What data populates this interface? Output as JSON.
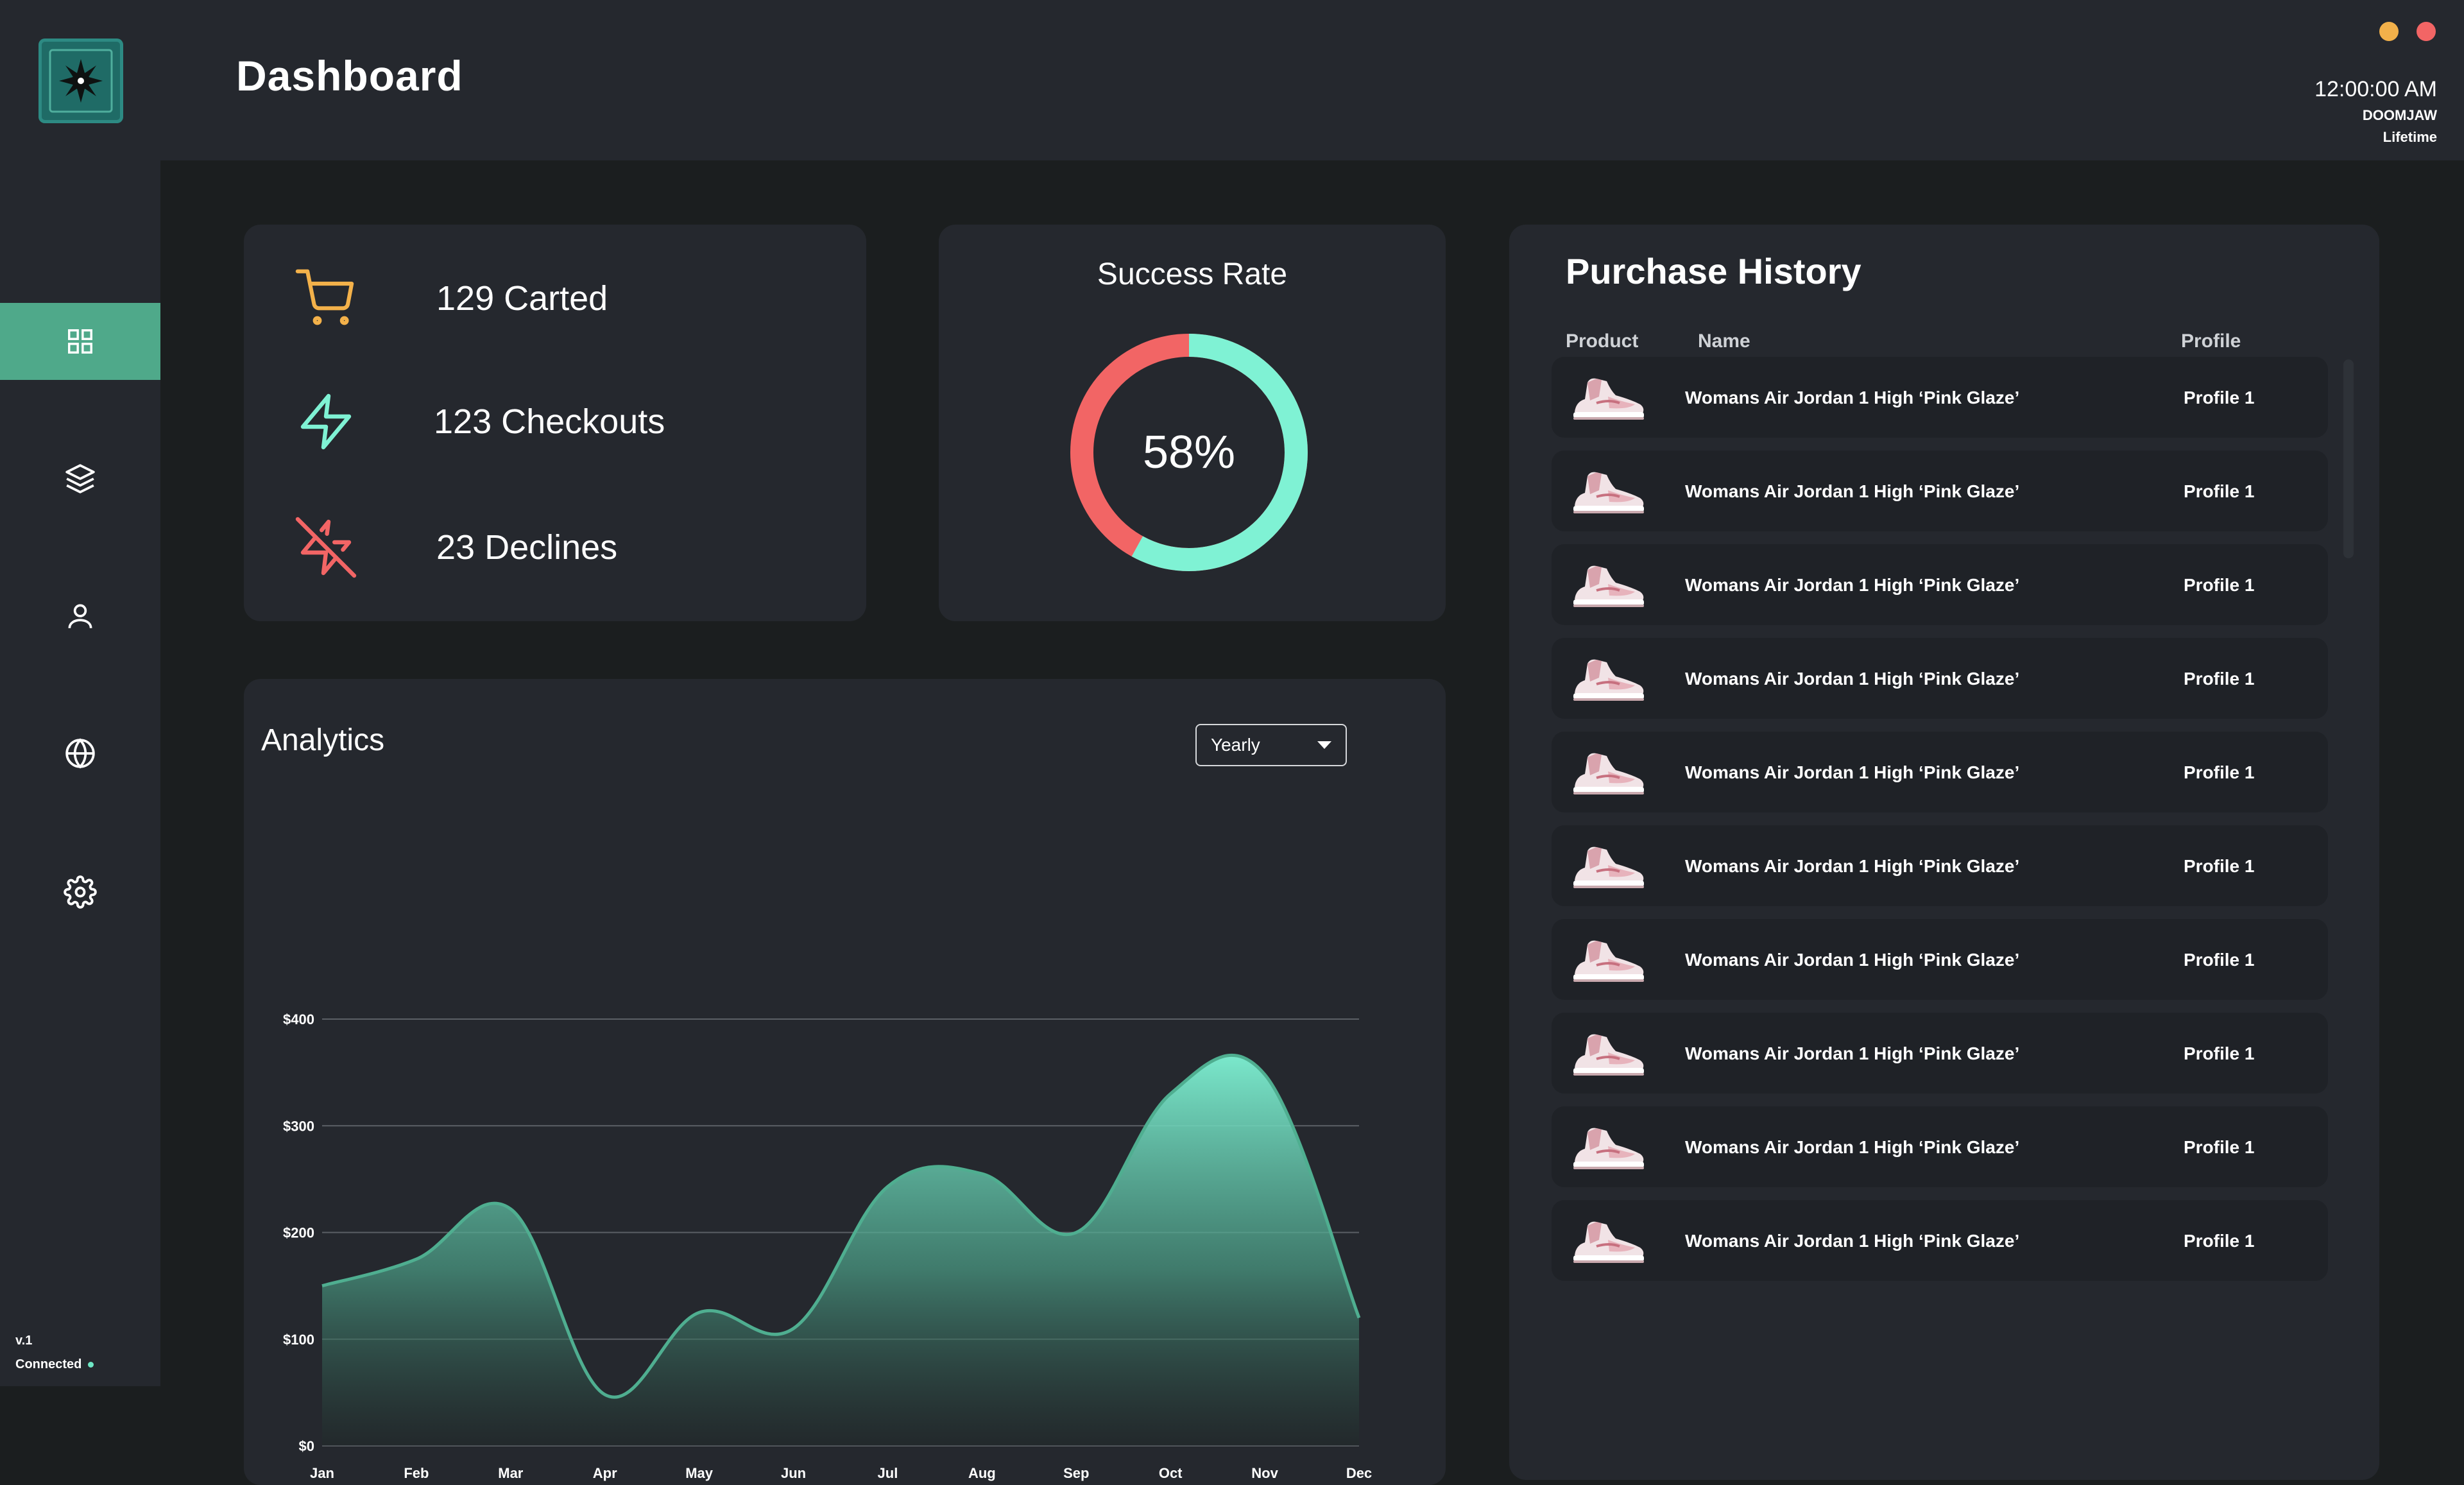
{
  "header": {
    "title": "Dashboard",
    "time": "12:00:00 AM",
    "user": "DOOMJAW",
    "plan": "Lifetime"
  },
  "sidebar": {
    "items": [
      {
        "icon": "grid-icon",
        "active": true
      },
      {
        "icon": "layers-icon",
        "active": false
      },
      {
        "icon": "user-icon",
        "active": false
      },
      {
        "icon": "globe-icon",
        "active": false
      },
      {
        "icon": "gear-icon",
        "active": false
      }
    ],
    "version": "v.1",
    "status": "Connected"
  },
  "stats": {
    "carted": "129 Carted",
    "checkouts": "123 Checkouts",
    "declines": "23 Declines"
  },
  "success_rate": {
    "title": "Success Rate",
    "label": "58%",
    "value": 0.58
  },
  "analytics": {
    "title": "Analytics",
    "period": "Yearly"
  },
  "chart_data": {
    "type": "area",
    "categories": [
      "Jan",
      "Feb",
      "Mar",
      "Apr",
      "May",
      "Jun",
      "Jul",
      "Aug",
      "Sep",
      "Oct",
      "Nov",
      "Dec"
    ],
    "series": [
      {
        "values": [
          150,
          175,
          222,
          48,
          125,
          110,
          243,
          255,
          200,
          330,
          348,
          120
        ]
      }
    ],
    "y_ticks": [
      "$0",
      "$100",
      "$200",
      "$300",
      "$400"
    ],
    "ylim": [
      0,
      400
    ],
    "grid": true
  },
  "purchase_history": {
    "title": "Purchase History",
    "columns": {
      "product": "Product",
      "name": "Name",
      "profile": "Profile"
    },
    "rows": [
      {
        "name": "Womans Air Jordan 1 High ‘Pink Glaze’",
        "profile": "Profile 1"
      },
      {
        "name": "Womans Air Jordan 1 High ‘Pink Glaze’",
        "profile": "Profile 1"
      },
      {
        "name": "Womans Air Jordan 1 High ‘Pink Glaze’",
        "profile": "Profile 1"
      },
      {
        "name": "Womans Air Jordan 1 High ‘Pink Glaze’",
        "profile": "Profile 1"
      },
      {
        "name": "Womans Air Jordan 1 High ‘Pink Glaze’",
        "profile": "Profile 1"
      },
      {
        "name": "Womans Air Jordan 1 High ‘Pink Glaze’",
        "profile": "Profile 1"
      },
      {
        "name": "Womans Air Jordan 1 High ‘Pink Glaze’",
        "profile": "Profile 1"
      },
      {
        "name": "Womans Air Jordan 1 High ‘Pink Glaze’",
        "profile": "Profile 1"
      },
      {
        "name": "Womans Air Jordan 1 High ‘Pink Glaze’",
        "profile": "Profile 1"
      },
      {
        "name": "Womans Air Jordan 1 High ‘Pink Glaze’",
        "profile": "Profile 1"
      }
    ]
  },
  "colors": {
    "accent": "#4fa98a",
    "mint": "#7ff2d4",
    "red": "#f26565",
    "orange": "#f3b14a"
  }
}
